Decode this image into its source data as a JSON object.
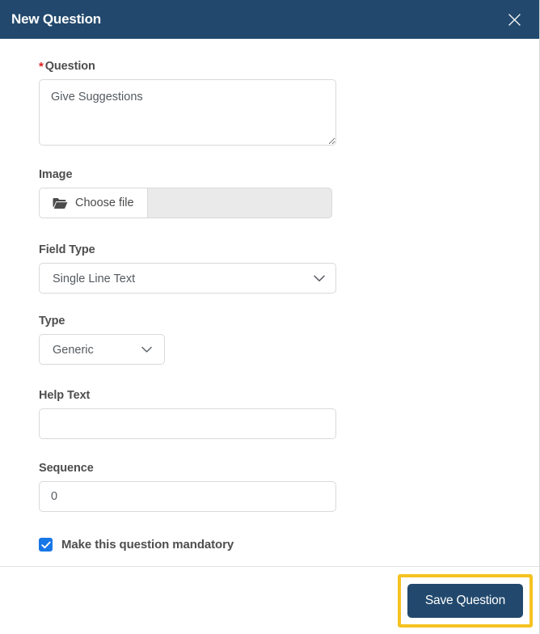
{
  "header": {
    "title": "New Question",
    "close_icon": "close-icon"
  },
  "form": {
    "question": {
      "label": "Question",
      "required_marker": "*",
      "value": "Give Suggestions",
      "placeholder": ""
    },
    "image": {
      "label": "Image",
      "choose_file_label": "Choose file",
      "folder_icon": "folder-icon",
      "file_name_value": "",
      "file_name_placeholder": ""
    },
    "field_type": {
      "label": "Field Type",
      "selected": "Single Line Text",
      "chevron_icon": "chevron-down-icon"
    },
    "type": {
      "label": "Type",
      "selected": "Generic",
      "chevron_icon": "chevron-down-icon"
    },
    "help_text": {
      "label": "Help Text",
      "value": "",
      "placeholder": ""
    },
    "sequence": {
      "label": "Sequence",
      "value": "0",
      "placeholder": ""
    },
    "mandatory": {
      "label": "Make this question mandatory",
      "checked": "true",
      "check_icon": "check-icon"
    }
  },
  "footer": {
    "save_label": "Save Question"
  },
  "colors": {
    "header_bg": "#22496d",
    "primary_button_bg": "#22496d",
    "highlight_border": "#f5c320",
    "required_star": "#e02020",
    "checkbox_accent": "#1877e6",
    "field_border": "#d7d9dc",
    "disabled_field_bg": "#eaeaea",
    "label_text": "#4e4e4e"
  }
}
